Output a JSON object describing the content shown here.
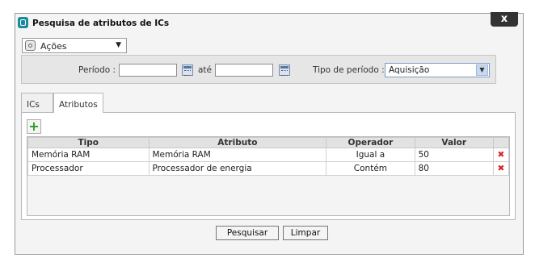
{
  "dialog": {
    "title": "Pesquisa de atributos de ICs",
    "close_label": "x"
  },
  "actions": {
    "label": "Ações",
    "arrow": "▼"
  },
  "filter": {
    "period_label": "Período :",
    "period_from_value": "",
    "ate_label": "até",
    "period_to_value": "",
    "type_label": "Tipo de período :",
    "type_value": "Aquisição"
  },
  "tabs": [
    {
      "label": "ICs",
      "active": false
    },
    {
      "label": "Atributos",
      "active": true
    }
  ],
  "grid": {
    "add_symbol": "+",
    "headers": [
      "Tipo",
      "Atributo",
      "Operador",
      "Valor"
    ],
    "rows": [
      {
        "tipo": "Memória RAM",
        "atributo": "Memória RAM",
        "operador": "Igual a",
        "valor": "50",
        "delete": "✖"
      },
      {
        "tipo": "Processador",
        "atributo": "Processador de energia",
        "operador": "Contém",
        "valor": "80",
        "delete": "✖"
      }
    ]
  },
  "buttons": {
    "search": "Pesquisar",
    "clear": "Limpar"
  },
  "colors": {
    "accent": "#1c8a98",
    "delete": "#e02020",
    "add": "#2a9a2a"
  }
}
